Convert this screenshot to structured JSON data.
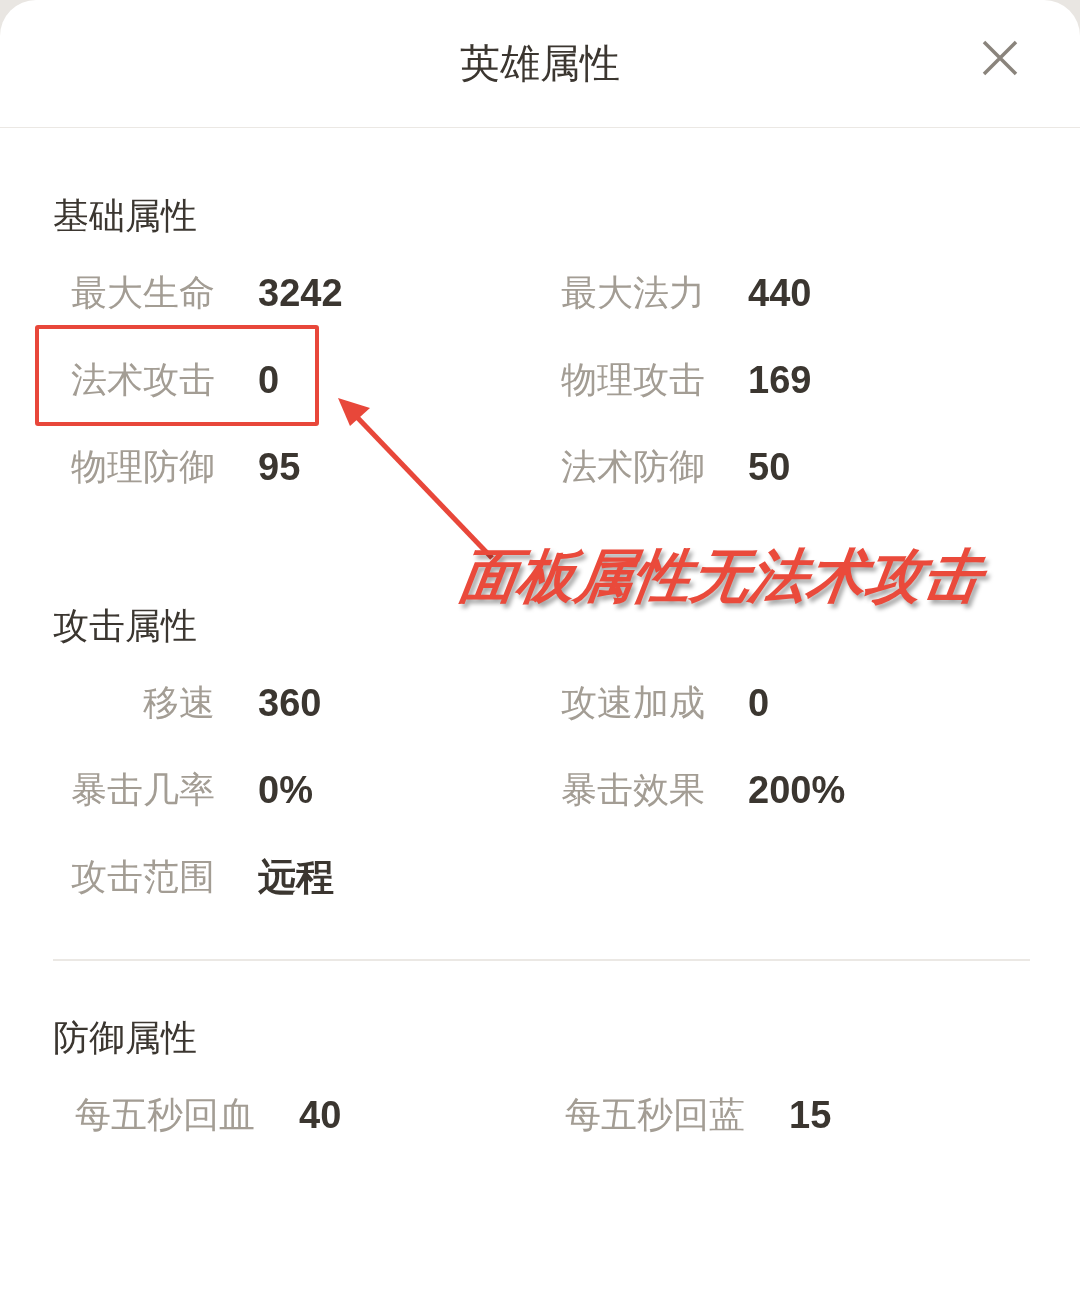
{
  "window": {
    "title": "英雄属性"
  },
  "sections": [
    {
      "title": "基础属性",
      "stats": [
        {
          "label": "最大生命",
          "value": "3242",
          "highlighted": false
        },
        {
          "label": "最大法力",
          "value": "440",
          "highlighted": false
        },
        {
          "label": "法术攻击",
          "value": "0",
          "highlighted": true
        },
        {
          "label": "物理攻击",
          "value": "169",
          "highlighted": false
        },
        {
          "label": "物理防御",
          "value": "95",
          "highlighted": false
        },
        {
          "label": "法术防御",
          "value": "50",
          "highlighted": false
        }
      ]
    },
    {
      "title": "攻击属性",
      "stats": [
        {
          "label": "移速",
          "value": "360",
          "highlighted": false
        },
        {
          "label": "攻速加成",
          "value": "0",
          "highlighted": false
        },
        {
          "label": "暴击几率",
          "value": "0%",
          "highlighted": false
        },
        {
          "label": "暴击效果",
          "value": "200%",
          "highlighted": false
        },
        {
          "label": "攻击范围",
          "value": "远程",
          "highlighted": false
        }
      ]
    },
    {
      "title": "防御属性",
      "stats": [
        {
          "label": "每五秒回血",
          "value": "40",
          "highlighted": false
        },
        {
          "label": "每五秒回蓝",
          "value": "15",
          "highlighted": false
        }
      ]
    }
  ],
  "annotation": {
    "text": "面板属性无法术攻击"
  }
}
